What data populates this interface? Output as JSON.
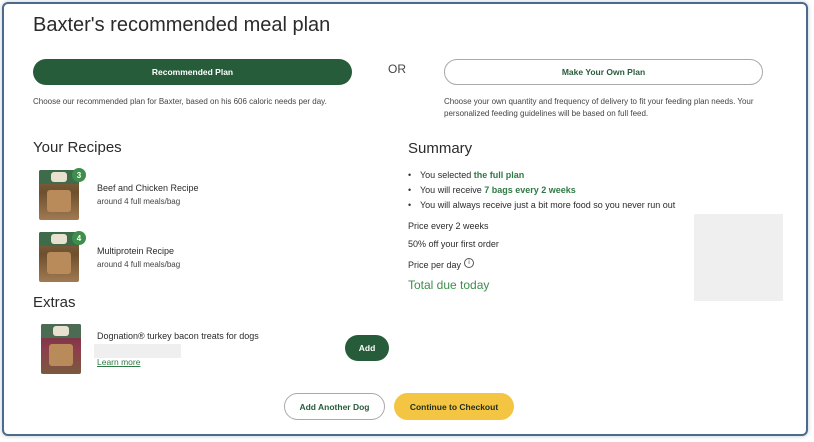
{
  "page_title": "Baxter's recommended meal plan",
  "plan_options": {
    "recommended_label": "Recommended Plan",
    "or_label": "OR",
    "own_label": "Make Your Own Plan",
    "recommended_desc": "Choose our recommended plan for Baxter, based on his 606 caloric needs per day.",
    "own_desc": "Choose your own quantity and frequency of delivery to fit your feeding plan needs. Your personalized feeding guidelines will be based on full feed."
  },
  "recipes": {
    "heading": "Your Recipes",
    "items": [
      {
        "name": "Beef and Chicken Recipe",
        "subtitle": "around 4 full meals/bag",
        "quantity": "3"
      },
      {
        "name": "Multiprotein Recipe",
        "subtitle": "around 4 full meals/bag",
        "quantity": "4"
      }
    ]
  },
  "extras": {
    "heading": "Extras",
    "item_name": "Dognation® turkey bacon treats for dogs",
    "learn_more": "Learn more",
    "add_label": "Add"
  },
  "summary": {
    "heading": "Summary",
    "line1_prefix": "You selected ",
    "line1_highlight": "the full plan",
    "line2_prefix": "You will receive ",
    "line2_highlight": "7 bags every 2 weeks",
    "line3": "You will always receive just a bit more food so you never run out",
    "price_every": "Price every 2 weeks",
    "discount": "50% off your first order",
    "price_per_day": "Price per day",
    "info_glyph": "i",
    "total_due": "Total due today"
  },
  "footer": {
    "add_dog_label": "Add Another Dog",
    "checkout_label": "Continue to Checkout"
  },
  "colors": {
    "brand_green": "#275c3a",
    "accent_green": "#3e8e4c",
    "checkout_yellow": "#f4c542"
  },
  "icons": [
    "info-icon"
  ]
}
